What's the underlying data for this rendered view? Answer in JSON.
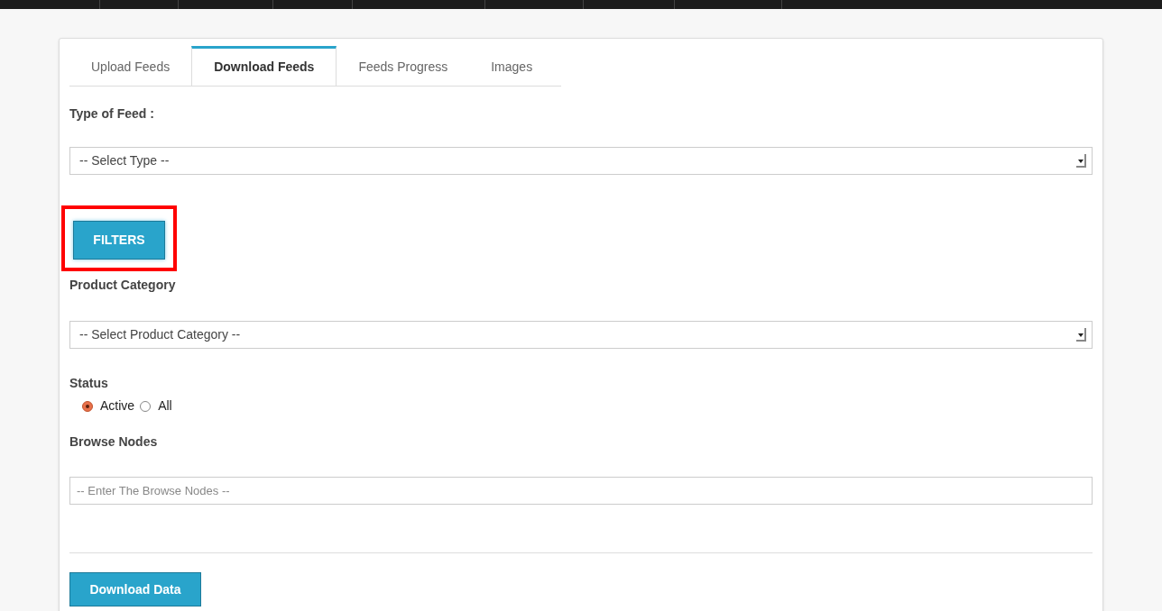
{
  "tabs": [
    {
      "label": "Upload Feeds",
      "selected": false
    },
    {
      "label": "Download Feeds",
      "selected": true
    },
    {
      "label": "Feeds Progress",
      "selected": false
    },
    {
      "label": "Images",
      "selected": false
    }
  ],
  "type_of_feed": {
    "label": "Type of Feed :",
    "value": "-- Select Type --"
  },
  "filters_button": {
    "label": "FILTERS",
    "highlighted": true
  },
  "product_category": {
    "label": "Product Category",
    "value": "-- Select Product Category --"
  },
  "status": {
    "label": "Status",
    "options": [
      {
        "label": "Active",
        "selected": true
      },
      {
        "label": "All",
        "selected": false
      }
    ]
  },
  "browse_nodes": {
    "label": "Browse Nodes",
    "placeholder": "-- Enter The Browse Nodes --"
  },
  "download_button": {
    "label": "Download Data"
  }
}
